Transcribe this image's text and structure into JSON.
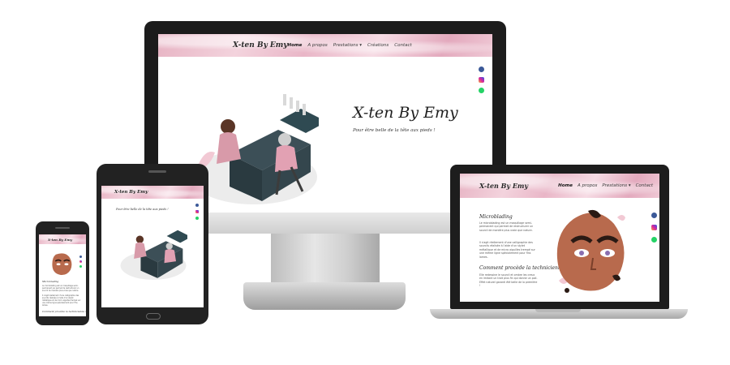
{
  "site": {
    "brand": "X-ten By Emy",
    "menu": [
      "Home",
      "A propos",
      "Prestations ▾",
      "Créations",
      "Contact"
    ],
    "hero_title": "X-ten By Emy",
    "hero_subtitle": "Pour être belle de la tête aux pieds !",
    "section1_title": "Microblading",
    "section1_p1": "Le microblading est un maquillage semi-permanent qui permet de restructurer un sourcil de manière plus vraie que nature.",
    "section1_p2": "Il s'agit réellement d'une calligraphie des sourcils réalisée à l'aide d'un stylet métallique et de micro aiguilles trempé sur une même ligne spécialement pour fins lames.",
    "section2_title": "Comment procède la technicienne ?",
    "section2_p1": "Elle redessine le sourcil et ombre les creux en imitant un trait plus fin qui donne un poil. Effet naturel garanti été belle de la première !",
    "social": [
      "facebook-icon",
      "instagram-icon",
      "whatsapp-icon"
    ]
  },
  "colors": {
    "header_pink": "#e9b6c7",
    "device_dark": "#1c1c1c",
    "skin": "#b86a4d",
    "accent_teal": "#2f4a52"
  }
}
